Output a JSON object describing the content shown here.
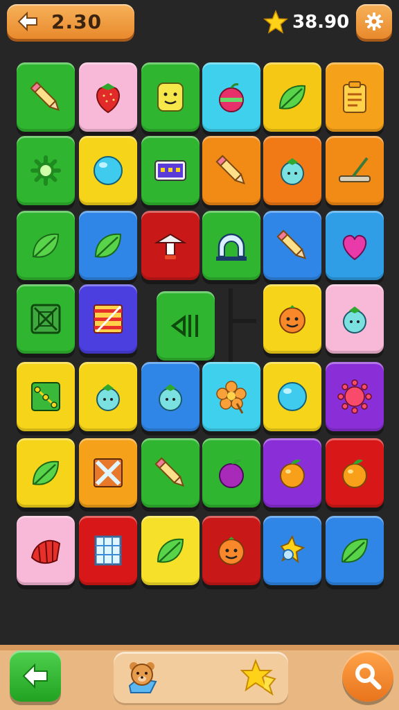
{
  "header": {
    "left_value": "2.30",
    "score_value": "38.90",
    "back_icon": "back-arrow-icon",
    "score_icon": "star-icon",
    "settings_icon": "gear-icon"
  },
  "board": {
    "tiles": [
      {
        "row": 0,
        "col": 0,
        "color": "#2fb52f",
        "icon": "pencil"
      },
      {
        "row": 0,
        "col": 1,
        "color": "#f8b8d8",
        "icon": "strawberry"
      },
      {
        "row": 0,
        "col": 2,
        "color": "#2fb52f",
        "icon": "smiley"
      },
      {
        "row": 0,
        "col": 3,
        "color": "#3fd0ee",
        "icon": "apple"
      },
      {
        "row": 0,
        "col": 4,
        "color": "#f6c816",
        "icon": "leaf"
      },
      {
        "row": 0,
        "col": 5,
        "color": "#f6a11a",
        "icon": "clipboard"
      },
      {
        "row": 1,
        "col": 0,
        "color": "#2fb52f",
        "icon": "sun"
      },
      {
        "row": 1,
        "col": 1,
        "color": "#f6d41a",
        "icon": "ball"
      },
      {
        "row": 1,
        "col": 2,
        "color": "#2fb52f",
        "icon": "box"
      },
      {
        "row": 1,
        "col": 3,
        "color": "#f28a16",
        "icon": "pencil"
      },
      {
        "row": 1,
        "col": 4,
        "color": "#f27a16",
        "icon": "berry"
      },
      {
        "row": 1,
        "col": 5,
        "color": "#f28a16",
        "icon": "scraper"
      },
      {
        "row": 2,
        "col": 0,
        "color": "#2fb52f",
        "icon": "leaf"
      },
      {
        "row": 2,
        "col": 1,
        "color": "#2f86e6",
        "icon": "leaf"
      },
      {
        "row": 2,
        "col": 2,
        "color": "#c81818",
        "icon": "lamp"
      },
      {
        "row": 2,
        "col": 3,
        "color": "#2fb52f",
        "icon": "arch"
      },
      {
        "row": 2,
        "col": 4,
        "color": "#2f86e6",
        "icon": "pencil"
      },
      {
        "row": 2,
        "col": 5,
        "color": "#2f9ee6",
        "icon": "heart"
      },
      {
        "row": 3,
        "col": 0,
        "color": "#2fb52f",
        "icon": "frame"
      },
      {
        "row": 3,
        "col": 1,
        "color": "#4b3fe0",
        "icon": "stripes"
      },
      {
        "row": 3,
        "col": 2,
        "color": "#2fb52f",
        "icon": "bars"
      },
      {
        "row": 3,
        "col": 4,
        "color": "#f6d41a",
        "icon": "face"
      },
      {
        "row": 3,
        "col": 5,
        "color": "#f8b8d8",
        "icon": "berry"
      },
      {
        "row": 4,
        "col": 0,
        "color": "#f6d41a",
        "icon": "dots"
      },
      {
        "row": 4,
        "col": 1,
        "color": "#f6d41a",
        "icon": "berry"
      },
      {
        "row": 4,
        "col": 2,
        "color": "#2f86e6",
        "icon": "berry"
      },
      {
        "row": 4,
        "col": 3,
        "color": "#3fd0ee",
        "icon": "flower"
      },
      {
        "row": 4,
        "col": 4,
        "color": "#f6d41a",
        "icon": "ball"
      },
      {
        "row": 4,
        "col": 5,
        "color": "#8a2fd8",
        "icon": "virus"
      },
      {
        "row": 5,
        "col": 0,
        "color": "#f6d41a",
        "icon": "leaf"
      },
      {
        "row": 5,
        "col": 1,
        "color": "#f6a11a",
        "icon": "cross"
      },
      {
        "row": 5,
        "col": 2,
        "color": "#2fb52f",
        "icon": "pencil"
      },
      {
        "row": 5,
        "col": 3,
        "color": "#2fb52f",
        "icon": "plum"
      },
      {
        "row": 5,
        "col": 4,
        "color": "#8a2fd8",
        "icon": "orange"
      },
      {
        "row": 5,
        "col": 5,
        "color": "#d81818",
        "icon": "orange"
      },
      {
        "row": 6,
        "col": 0,
        "color": "#f8b8d8",
        "icon": "shell"
      },
      {
        "row": 6,
        "col": 1,
        "color": "#d81818",
        "icon": "grid"
      },
      {
        "row": 6,
        "col": 2,
        "color": "#f6e02a",
        "icon": "leaf"
      },
      {
        "row": 6,
        "col": 3,
        "color": "#c81818",
        "icon": "face"
      },
      {
        "row": 6,
        "col": 4,
        "color": "#2f86e6",
        "icon": "sparkle"
      },
      {
        "row": 6,
        "col": 5,
        "color": "#2f86e6",
        "icon": "leaf"
      }
    ]
  },
  "bottom": {
    "back_icon": "back-arrow-icon",
    "search_icon": "magnifier-icon",
    "tray_items": [
      "bear-icon",
      "star-icon"
    ]
  }
}
